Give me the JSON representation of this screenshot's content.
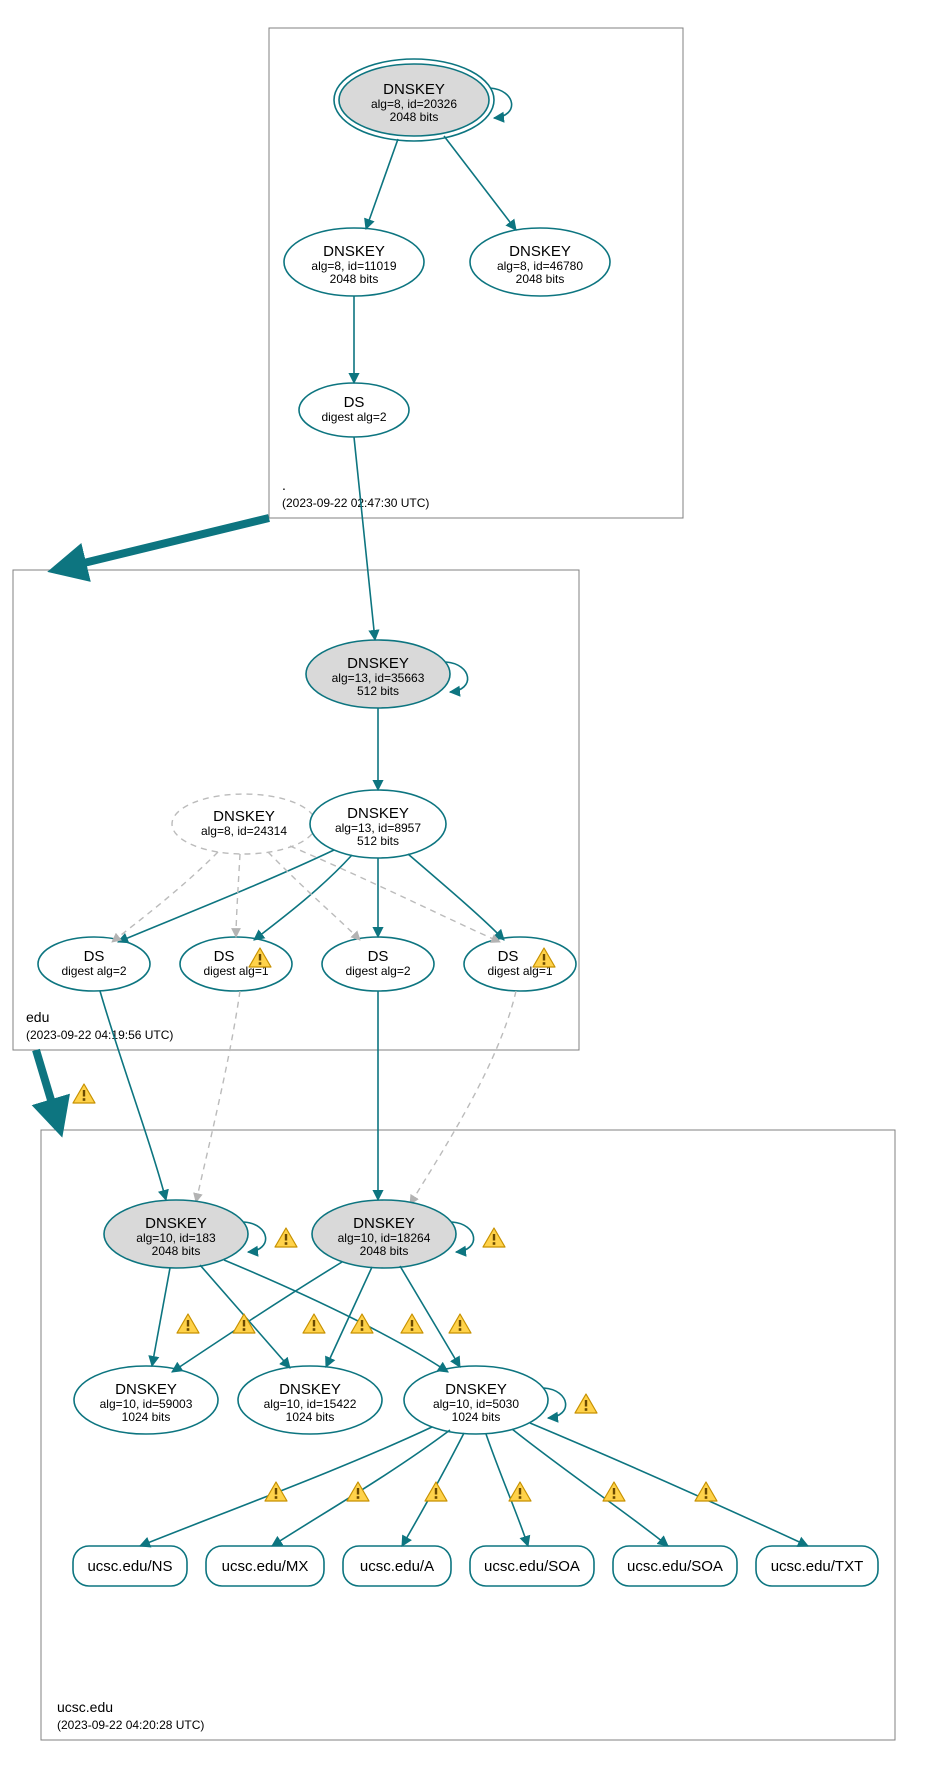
{
  "diagram": {
    "colors": {
      "teal": "#0d7580",
      "node_grey": "#d9d9d9",
      "dashed_grey": "#b3b3b3"
    },
    "zones": [
      {
        "id": "root",
        "label": ".",
        "timestamp": "(2023-09-22 02:47:30 UTC)"
      },
      {
        "id": "edu",
        "label": "edu",
        "timestamp": "(2023-09-22 04:19:56 UTC)"
      },
      {
        "id": "ucsc",
        "label": "ucsc.edu",
        "timestamp": "(2023-09-22 04:20:28 UTC)"
      }
    ],
    "nodes": {
      "root_ksk": {
        "title": "DNSKEY",
        "line2": "alg=8, id=20326",
        "line3": "2048 bits"
      },
      "root_zsk1": {
        "title": "DNSKEY",
        "line2": "alg=8, id=11019",
        "line3": "2048 bits"
      },
      "root_zsk2": {
        "title": "DNSKEY",
        "line2": "alg=8, id=46780",
        "line3": "2048 bits"
      },
      "root_ds": {
        "title": "DS",
        "line2": "digest alg=2"
      },
      "edu_ksk": {
        "title": "DNSKEY",
        "line2": "alg=13, id=35663",
        "line3": "512 bits"
      },
      "edu_zsk": {
        "title": "DNSKEY",
        "line2": "alg=13, id=8957",
        "line3": "512 bits"
      },
      "edu_dashed": {
        "title": "DNSKEY",
        "line2": "alg=8, id=24314"
      },
      "edu_ds1": {
        "title": "DS",
        "line2": "digest alg=2"
      },
      "edu_ds2": {
        "title": "DS",
        "line2": "digest alg=1"
      },
      "edu_ds3": {
        "title": "DS",
        "line2": "digest alg=2"
      },
      "edu_ds4": {
        "title": "DS",
        "line2": "digest alg=1"
      },
      "ucsc_ksk1": {
        "title": "DNSKEY",
        "line2": "alg=10, id=183",
        "line3": "2048 bits"
      },
      "ucsc_ksk2": {
        "title": "DNSKEY",
        "line2": "alg=10, id=18264",
        "line3": "2048 bits"
      },
      "ucsc_zsk1": {
        "title": "DNSKEY",
        "line2": "alg=10, id=59003",
        "line3": "1024 bits"
      },
      "ucsc_zsk2": {
        "title": "DNSKEY",
        "line2": "alg=10, id=15422",
        "line3": "1024 bits"
      },
      "ucsc_zsk3": {
        "title": "DNSKEY",
        "line2": "alg=10, id=5030",
        "line3": "1024 bits"
      },
      "rr_ns": {
        "title": "ucsc.edu/NS"
      },
      "rr_mx": {
        "title": "ucsc.edu/MX"
      },
      "rr_a": {
        "title": "ucsc.edu/A"
      },
      "rr_soa1": {
        "title": "ucsc.edu/SOA"
      },
      "rr_soa2": {
        "title": "ucsc.edu/SOA"
      },
      "rr_txt": {
        "title": "ucsc.edu/TXT"
      }
    }
  }
}
